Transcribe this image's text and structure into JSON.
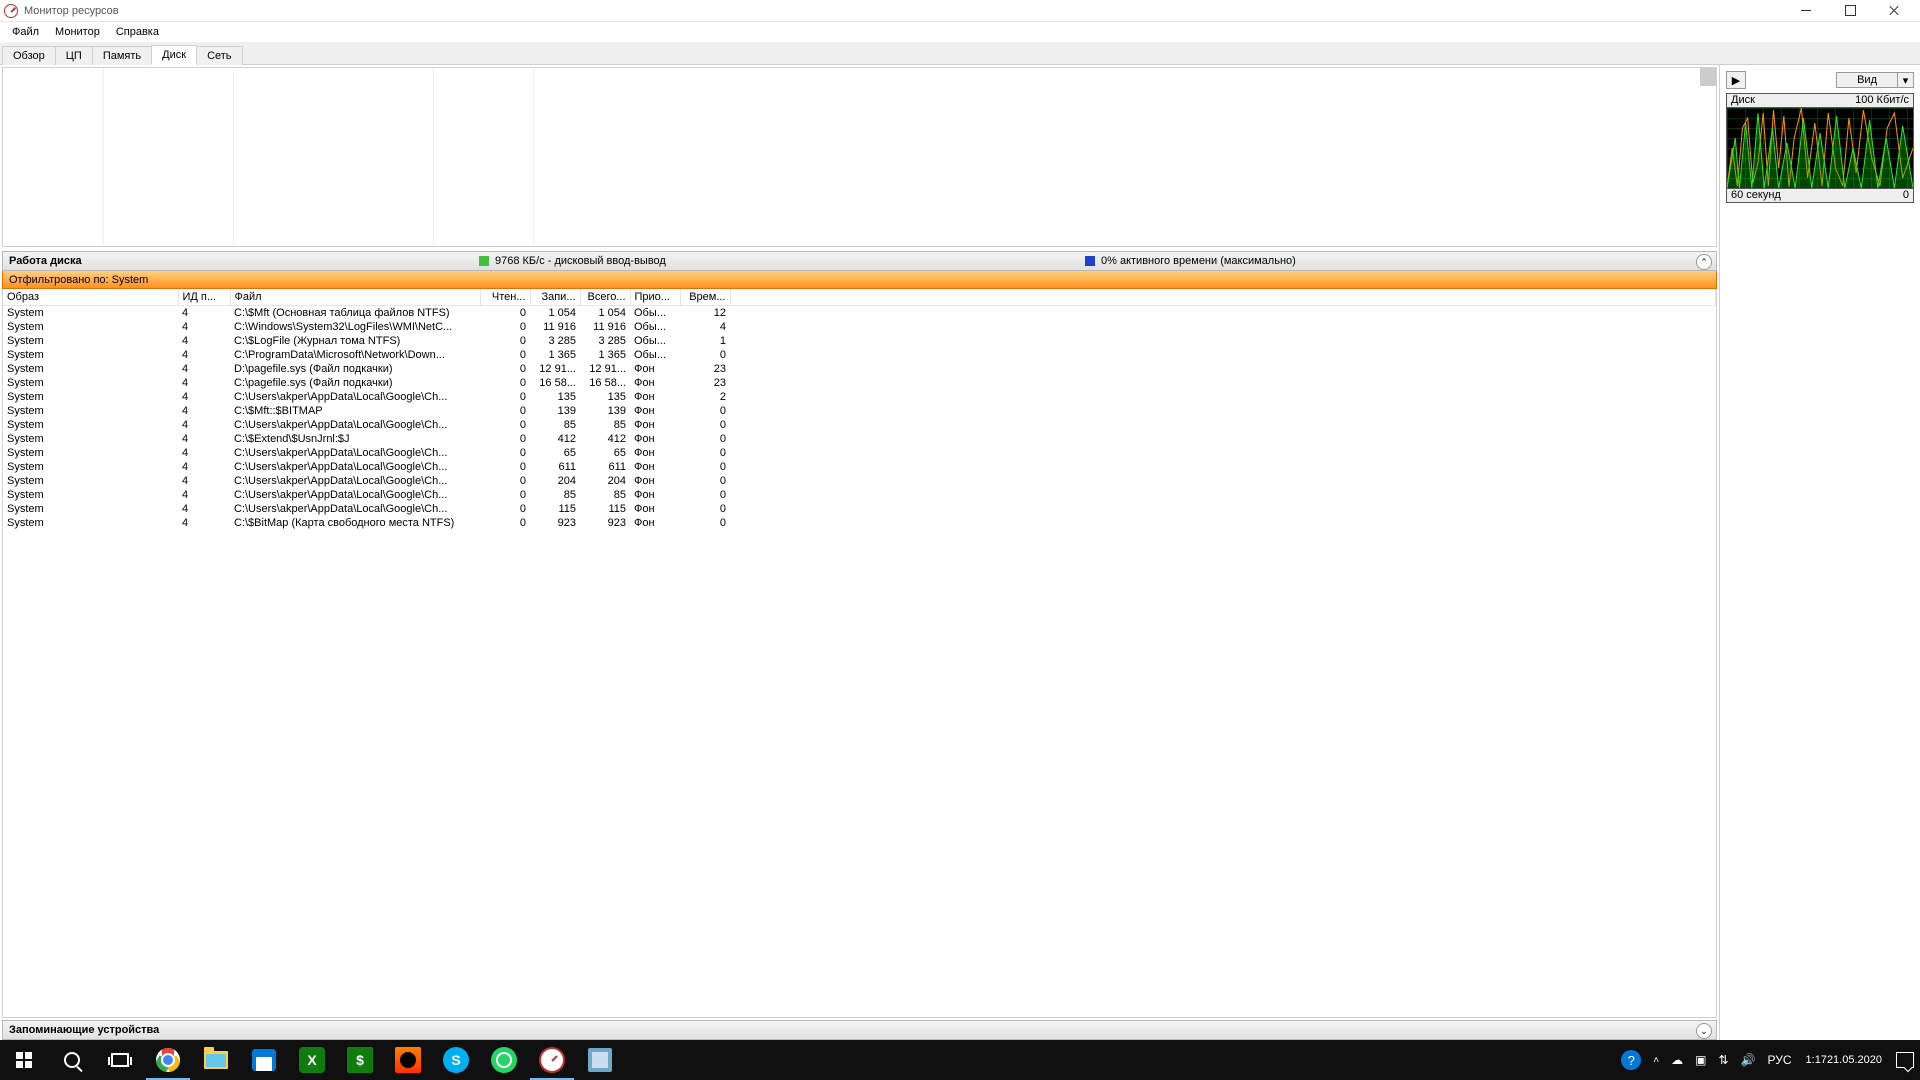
{
  "window": {
    "title": "Монитор ресурсов"
  },
  "menu": {
    "file": "Файл",
    "monitor": "Монитор",
    "help": "Справка"
  },
  "tabs": {
    "overview": "Обзор",
    "cpu": "ЦП",
    "memory": "Память",
    "disk": "Диск",
    "network": "Сеть"
  },
  "disk_section": {
    "title": "Работа диска",
    "throughput": "9768 КБ/с - дисковый ввод-вывод",
    "active_time": "0% активного времени (максимально)"
  },
  "filter_bar": "Отфильтровано по: System",
  "columns": {
    "image": "Образ",
    "pid": "ИД п...",
    "file": "Файл",
    "read": "Чтен...",
    "write": "Запи...",
    "total": "Всего...",
    "prio": "Прио...",
    "time": "Врем..."
  },
  "rows": [
    {
      "image": "System",
      "pid": "4",
      "file": "C:\\$Mft (Основная таблица файлов NTFS)",
      "read": "0",
      "write": "1 054",
      "total": "1 054",
      "prio": "Обы...",
      "time": "12"
    },
    {
      "image": "System",
      "pid": "4",
      "file": "C:\\Windows\\System32\\LogFiles\\WMI\\NetC...",
      "read": "0",
      "write": "11 916",
      "total": "11 916",
      "prio": "Обы...",
      "time": "4"
    },
    {
      "image": "System",
      "pid": "4",
      "file": "C:\\$LogFile (Журнал тома NTFS)",
      "read": "0",
      "write": "3 285",
      "total": "3 285",
      "prio": "Обы...",
      "time": "1"
    },
    {
      "image": "System",
      "pid": "4",
      "file": "C:\\ProgramData\\Microsoft\\Network\\Down...",
      "read": "0",
      "write": "1 365",
      "total": "1 365",
      "prio": "Обы...",
      "time": "0"
    },
    {
      "image": "System",
      "pid": "4",
      "file": "D:\\pagefile.sys (Файл подкачки)",
      "read": "0",
      "write": "12 91...",
      "total": "12 91...",
      "prio": "Фон",
      "time": "23"
    },
    {
      "image": "System",
      "pid": "4",
      "file": "C:\\pagefile.sys (Файл подкачки)",
      "read": "0",
      "write": "16 58...",
      "total": "16 58...",
      "prio": "Фон",
      "time": "23"
    },
    {
      "image": "System",
      "pid": "4",
      "file": "C:\\Users\\akper\\AppData\\Local\\Google\\Ch...",
      "read": "0",
      "write": "135",
      "total": "135",
      "prio": "Фон",
      "time": "2"
    },
    {
      "image": "System",
      "pid": "4",
      "file": "C:\\$Mft::$BITMAP",
      "read": "0",
      "write": "139",
      "total": "139",
      "prio": "Фон",
      "time": "0"
    },
    {
      "image": "System",
      "pid": "4",
      "file": "C:\\Users\\akper\\AppData\\Local\\Google\\Ch...",
      "read": "0",
      "write": "85",
      "total": "85",
      "prio": "Фон",
      "time": "0"
    },
    {
      "image": "System",
      "pid": "4",
      "file": "C:\\$Extend\\$UsnJrnl:$J",
      "read": "0",
      "write": "412",
      "total": "412",
      "prio": "Фон",
      "time": "0"
    },
    {
      "image": "System",
      "pid": "4",
      "file": "C:\\Users\\akper\\AppData\\Local\\Google\\Ch...",
      "read": "0",
      "write": "65",
      "total": "65",
      "prio": "Фон",
      "time": "0"
    },
    {
      "image": "System",
      "pid": "4",
      "file": "C:\\Users\\akper\\AppData\\Local\\Google\\Ch...",
      "read": "0",
      "write": "611",
      "total": "611",
      "prio": "Фон",
      "time": "0"
    },
    {
      "image": "System",
      "pid": "4",
      "file": "C:\\Users\\akper\\AppData\\Local\\Google\\Ch...",
      "read": "0",
      "write": "204",
      "total": "204",
      "prio": "Фон",
      "time": "0"
    },
    {
      "image": "System",
      "pid": "4",
      "file": "C:\\Users\\akper\\AppData\\Local\\Google\\Ch...",
      "read": "0",
      "write": "85",
      "total": "85",
      "prio": "Фон",
      "time": "0"
    },
    {
      "image": "System",
      "pid": "4",
      "file": "C:\\Users\\akper\\AppData\\Local\\Google\\Ch...",
      "read": "0",
      "write": "115",
      "total": "115",
      "prio": "Фон",
      "time": "0"
    },
    {
      "image": "System",
      "pid": "4",
      "file": "C:\\$BitMap (Карта свободного места NTFS)",
      "read": "0",
      "write": "923",
      "total": "923",
      "prio": "Фон",
      "time": "0"
    }
  ],
  "storage_section": {
    "title": "Запоминающие устройства"
  },
  "right_pane": {
    "view_btn": "Вид",
    "graph": {
      "title_left": "Диск",
      "title_right": "100 Кбит/с",
      "footer_left": "60 секунд",
      "footer_right": "0"
    }
  },
  "taskbar": {
    "lang": "РУС",
    "time": "1:17",
    "date": "21.05.2020"
  }
}
